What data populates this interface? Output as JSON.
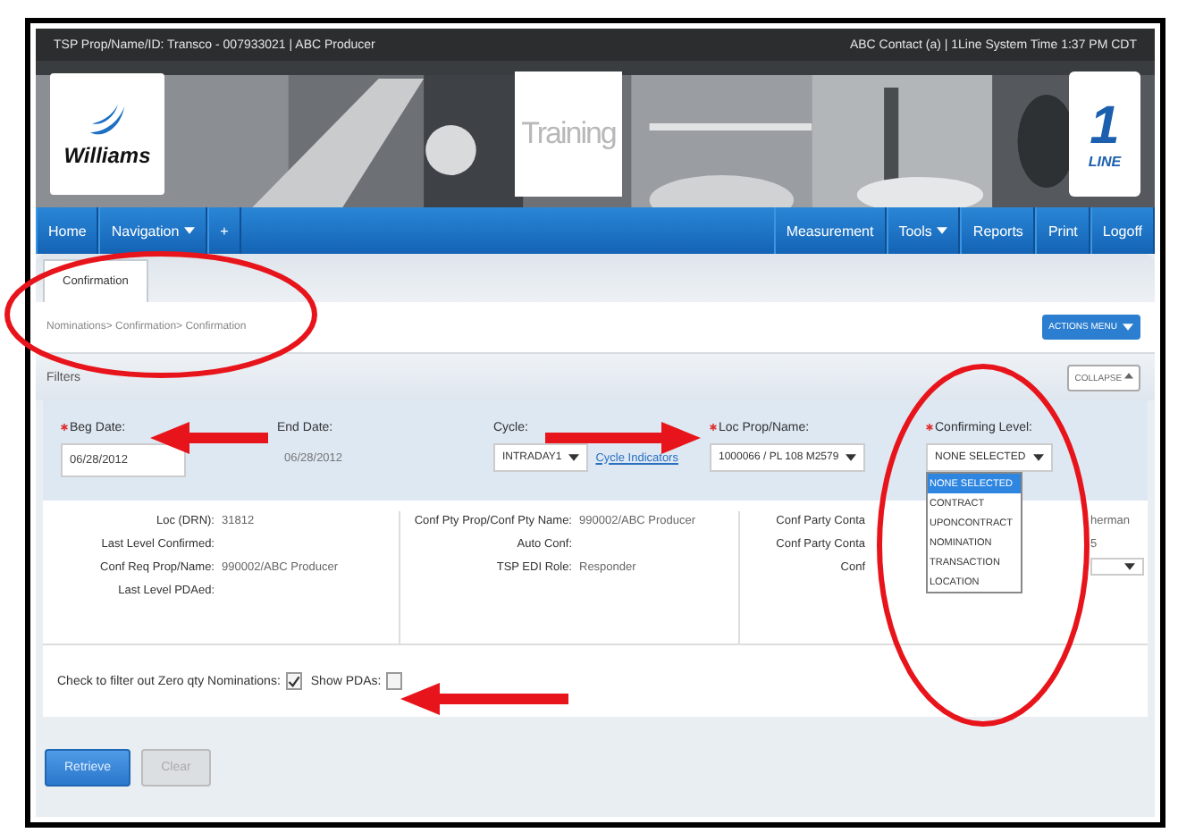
{
  "top_bar": {
    "left": "TSP Prop/Name/ID: Transco - 007933021 | ABC Producer",
    "right": "ABC Contact (a) | 1Line System Time 1:37 PM CDT"
  },
  "banner": {
    "logo": "Williams",
    "title": "Training",
    "brand_number": "1",
    "brand_word": "LINE"
  },
  "nav": {
    "left": [
      {
        "label": "Home",
        "dropdown": false
      },
      {
        "label": "Navigation",
        "dropdown": true
      },
      {
        "label": "+",
        "dropdown": false
      }
    ],
    "right": [
      {
        "label": "Measurement",
        "dropdown": false
      },
      {
        "label": "Tools",
        "dropdown": true
      },
      {
        "label": "Reports",
        "dropdown": false
      },
      {
        "label": "Print",
        "dropdown": false
      },
      {
        "label": "Logoff",
        "dropdown": false
      }
    ]
  },
  "tabs": [
    {
      "label": "Confirmation",
      "selected": true
    }
  ],
  "breadcrumb": "Nominations> Confirmation> Confirmation",
  "actions_button": "ACTIONS MENU",
  "filters": {
    "title": "Filters",
    "collapse_button": "COLLAPSE",
    "fields": [
      {
        "kind": "input",
        "label": "Beg Date:",
        "required": true,
        "value": "06/28/2012"
      },
      {
        "kind": "text",
        "label": "End Date:",
        "required": false,
        "value": "06/28/2012"
      },
      {
        "kind": "select",
        "label": "Cycle:",
        "required": false,
        "value": "INTRADAY1",
        "link": "Cycle Indicators"
      },
      {
        "kind": "select",
        "label": "Loc Prop/Name:",
        "required": true,
        "value": "1000066 / PL 108 M2579"
      },
      {
        "kind": "select",
        "label": "Confirming Level:",
        "required": true,
        "value": "NONE SELECTED",
        "open": true
      }
    ]
  },
  "dropdown_options": [
    {
      "label": "NONE SELECTED",
      "selected": true
    },
    {
      "label": "CONTRACT",
      "selected": false
    },
    {
      "label": "UPONCONTRACT",
      "selected": false
    },
    {
      "label": "NOMINATION",
      "selected": false
    },
    {
      "label": "TRANSACTION",
      "selected": false
    },
    {
      "label": "LOCATION",
      "selected": false
    }
  ],
  "info": {
    "left": [
      {
        "label": "Loc (DRN):",
        "value": "31812"
      },
      {
        "label": "Last Level Confirmed:"
      },
      {
        "label": "Conf Req Prop/Name:",
        "value": "990002/ABC Producer"
      },
      {
        "label": "Last Level PDAed:"
      }
    ],
    "middle": [
      {
        "label": "Conf Pty Prop/Conf Pty Name:",
        "value": "990002/ABC Producer"
      },
      {
        "label": "Auto Conf:"
      },
      {
        "label": "TSP EDI Role:",
        "value": "Responder"
      }
    ],
    "right": [
      {
        "kind": "text",
        "label": "Conf Party Conta",
        "value": "herman"
      },
      {
        "kind": "text",
        "label": "Conf Party Conta",
        "value": "5"
      },
      {
        "kind": "select",
        "label": "Conf"
      }
    ]
  },
  "options": [
    {
      "label": "Check to filter out Zero qty Nominations:",
      "checked": true
    },
    {
      "label": "Show PDAs:",
      "checked": false
    }
  ],
  "buttons": [
    {
      "label": "Retrieve",
      "kind": "primary"
    },
    {
      "label": "Clear",
      "kind": "secondary"
    }
  ]
}
